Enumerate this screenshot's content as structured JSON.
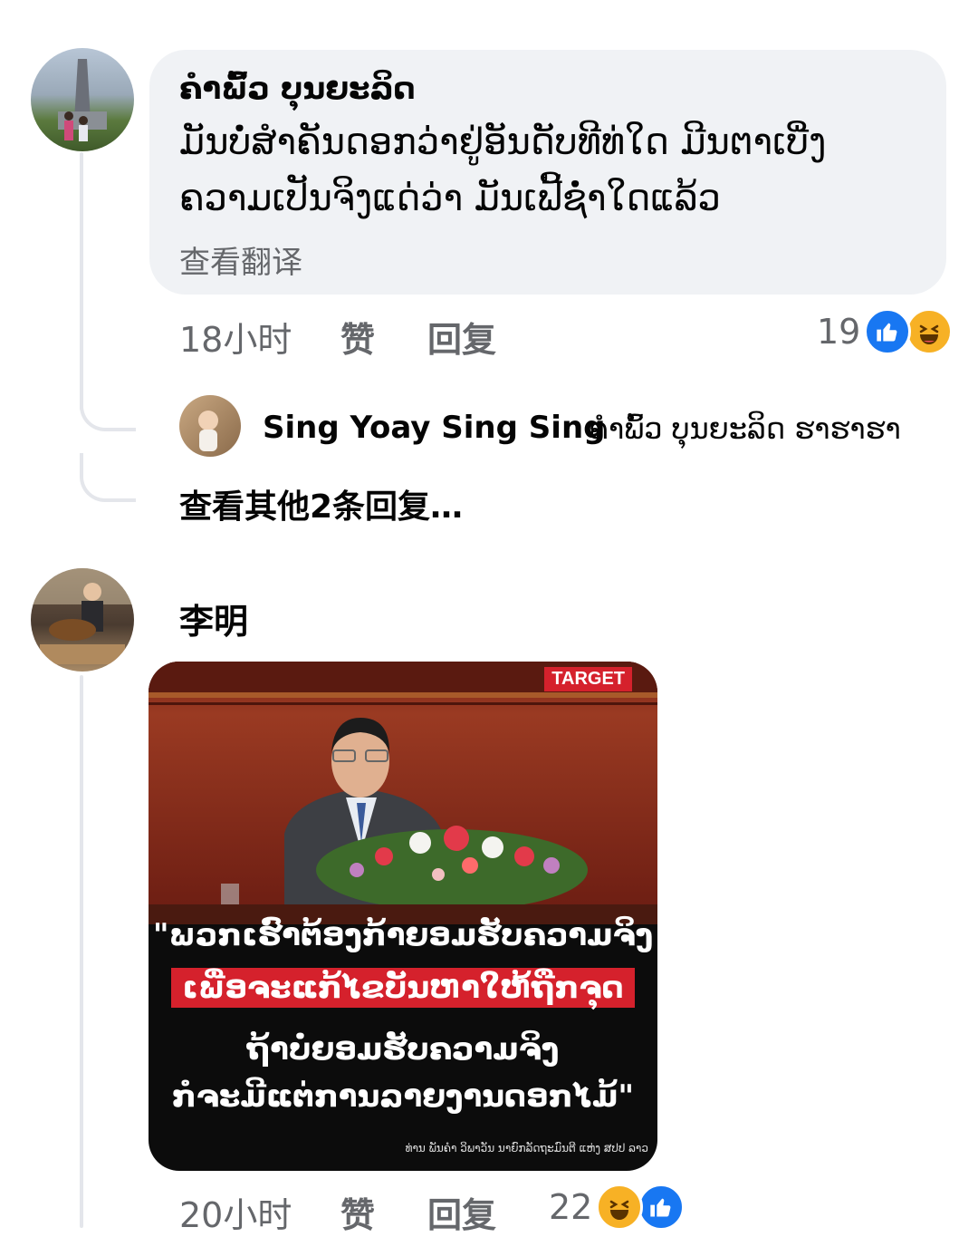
{
  "comment1": {
    "author": "ຄຳພົ້ວ ບຸນຍະລິດ",
    "text_line1": "ມັນບໍ່ສຳຄັນດອກວ່າຢູ່ອັນດັບທີທ່ໃດ ມີນຕາເບີ່ງ",
    "text_line2": "ຄວາມເປັນຈິງແດ່ວ່າ ມັນເຟີ້ຊໍ່າໃດແລ້ວ",
    "see_translation": "查看翻译",
    "time": "18小时",
    "like_label": "赞",
    "reply_label": "回复",
    "reaction_count": "19",
    "reactions": [
      "like-icon",
      "haha-icon"
    ]
  },
  "reply": {
    "author": "Sing Yoay Sing Sing",
    "text": "ຄຳພົ້ວ ບຸນຍະລິດ ຮາຮາຮາ",
    "more_replies": "查看其他2条回复…"
  },
  "comment2": {
    "author": "李明",
    "time": "20小时",
    "like_label": "赞",
    "reply_label": "回复",
    "reaction_count": "22",
    "reactions": [
      "haha-icon",
      "like-icon"
    ],
    "card": {
      "badge": "TARGET",
      "quote_line1": "\"ພວກເຮົາຕ້ອງກ້າຍອມຮັບຄວາມຈິງ",
      "quote_line2": "ເພື່ອຈະແກ້ໄຂບັນຫາໃຫ້ຖືກຈຸດ",
      "quote_line3": "ຖ້າບໍ່ຍອມຮັບຄວາມຈິງ",
      "quote_line4": "ກໍຈະມີແຕ່ການລາຍງານດອກໄມ້\"",
      "caption": "ທ່ານ ພັນຄຳ ວິພາວັນ ນາຍົກລັດຖະມົນຕີ ແຫ່ງ ສປປ ລາວ"
    }
  },
  "colors": {
    "bubble": "#f0f2f5",
    "meta": "#65676b",
    "like": "#1877f2",
    "haha": "#f7b125",
    "highlight": "#d5212c"
  }
}
